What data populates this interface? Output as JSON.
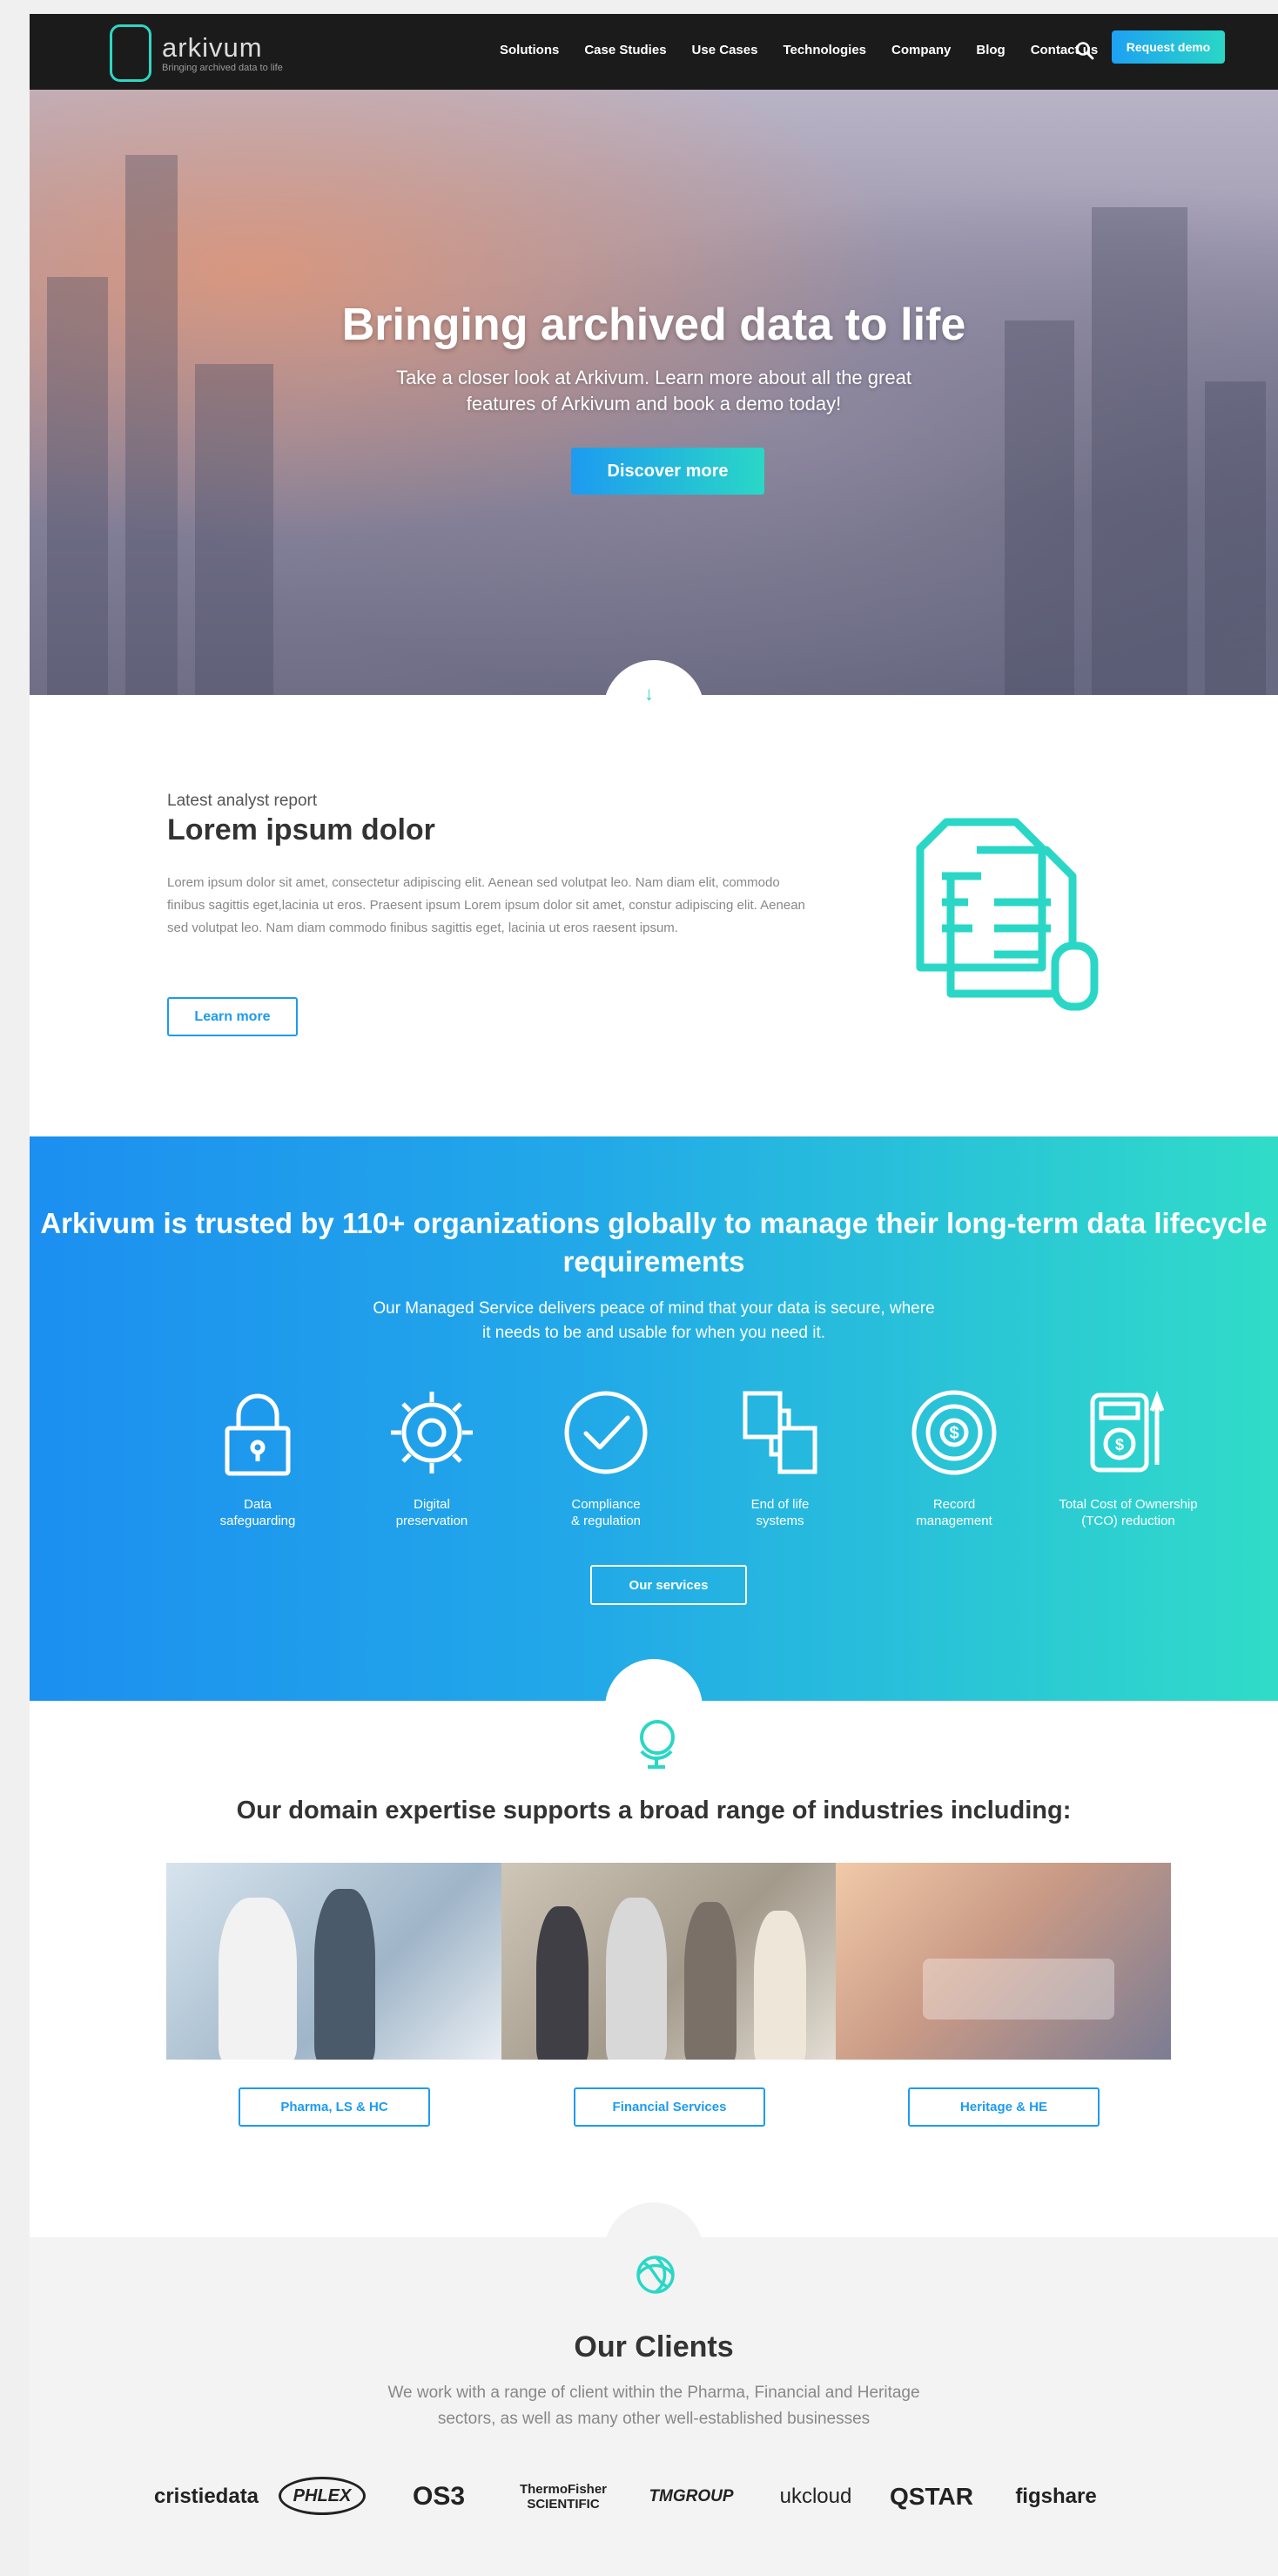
{
  "nav": {
    "logo_name": "arkivum",
    "logo_tagline": "Bringing archived data to life",
    "menu": [
      "Solutions",
      "Case Studies",
      "Use Cases",
      "Technologies",
      "Company",
      "Blog",
      "Contact us"
    ],
    "cta": "Request demo"
  },
  "hero": {
    "title": "Bringing archived data to life",
    "subtitle": "Take a closer look at Arkivum. Learn more about all the great features of Arkivum and book a demo today!",
    "button": "Discover more"
  },
  "report": {
    "kicker": "Latest analyst report",
    "title": "Lorem ipsum dolor",
    "body": "Lorem ipsum dolor sit amet, consectetur adipiscing elit. Aenean sed volutpat leo. Nam diam elit, commodo finibus sagittis eget,lacinia ut eros. Praesent ipsum Lorem ipsum dolor sit amet, constur adipiscing elit. Aenean sed volutpat leo. Nam diam commodo finibus sagittis eget, lacinia ut eros raesent ipsum.",
    "button": "Learn more"
  },
  "trusted": {
    "title": "Arkivum is trusted by 110+ organizations globally to manage their long-term data lifecycle requirements",
    "subtitle": "Our Managed Service delivers peace of mind that your data is secure, where it needs to be and usable for when you need it.",
    "features": [
      {
        "label": "Data\nsafeguarding",
        "icon": "padlock-icon"
      },
      {
        "label": "Digital\npreservation",
        "icon": "gear-icon"
      },
      {
        "label": "Compliance\n& regulation",
        "icon": "checkmark-circle-icon"
      },
      {
        "label": "End of life\nsystems",
        "icon": "transfer-boxes-icon"
      },
      {
        "label": "Record\nmanagement",
        "icon": "money-dial-icon"
      },
      {
        "label": "Total Cost of Ownership\n(TCO) reduction",
        "icon": "calculator-icon"
      }
    ],
    "button": "Our services"
  },
  "industries": {
    "title": "Our domain expertise supports a broad range of industries including:",
    "buttons": [
      "Pharma, LS & HC",
      "Financial Services",
      "Heritage & HE"
    ]
  },
  "clients": {
    "title": "Our Clients",
    "description": "We work with a range of client within the Pharma, Financial and Heritage sectors, as well as many other well-established businesses",
    "logos": [
      "cristiedata",
      "PHLEX",
      "OS3",
      "ThermoFisher SCIENTIFIC",
      "TMGROUP",
      "ukcloud",
      "QSTAR",
      "figshare"
    ]
  },
  "colors": {
    "accent_blue": "#1d9bf0",
    "accent_teal": "#2ad7c6",
    "nav_bg": "#1b1b1b"
  }
}
